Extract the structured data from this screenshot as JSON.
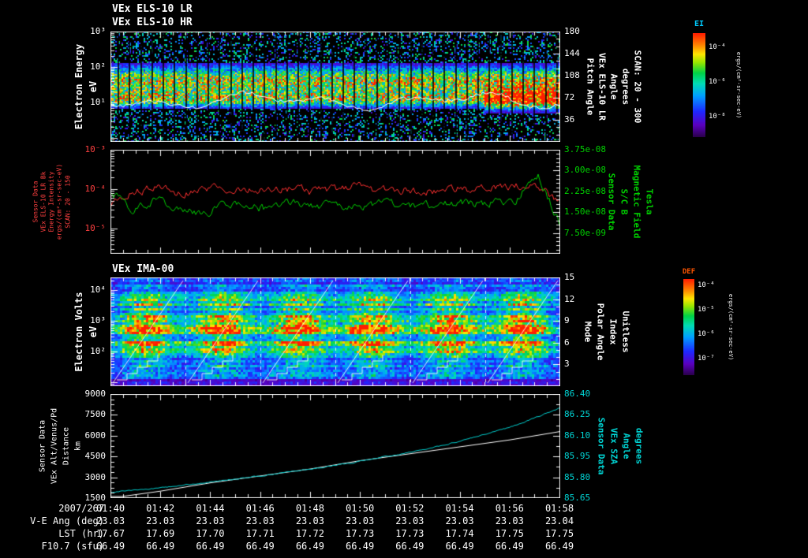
{
  "time_axis": {
    "date": "2007/267",
    "ticks": [
      "01:40",
      "01:42",
      "01:44",
      "01:46",
      "01:48",
      "01:50",
      "01:52",
      "01:54",
      "01:56",
      "01:58"
    ]
  },
  "footer_rows": [
    {
      "label": "V-E Ang (deg)",
      "values": [
        "23.03",
        "23.03",
        "23.03",
        "23.03",
        "23.03",
        "23.03",
        "23.03",
        "23.03",
        "23.03",
        "23.04"
      ]
    },
    {
      "label": "LST (hr)",
      "values": [
        "17.67",
        "17.69",
        "17.70",
        "17.71",
        "17.72",
        "17.73",
        "17.73",
        "17.74",
        "17.75",
        "17.75"
      ]
    },
    {
      "label": "F10.7 (sfu)",
      "values": [
        "66.49",
        "66.49",
        "66.49",
        "66.49",
        "66.49",
        "66.49",
        "66.49",
        "66.49",
        "66.49",
        "66.49"
      ]
    }
  ],
  "chart_data": [
    {
      "type": "heatmap",
      "name": "els_energy_spectrogram",
      "title_lines": [
        "VEx ELS-10 LR",
        "VEx ELS-10 HR"
      ],
      "description": "Electron energy-time spectrogram; intense 10-300 eV band, strongest red flux after 01:55, white pitch-angle trace overlay, vertical sweep gaps",
      "left_axis": {
        "label": "Electron Energy",
        "unit": "eV",
        "scale": "log",
        "ticks": [
          "10³",
          "10²",
          "10¹"
        ]
      },
      "right_axis": {
        "label_lines": [
          "Pitch Angle",
          "VEx ELS-10 LR",
          "Angle",
          "degrees",
          "SCAN: 20 - 300"
        ],
        "ticks": [
          "180",
          "144",
          "108",
          "72",
          "36"
        ],
        "range": [
          0,
          180
        ]
      },
      "colorbar": {
        "title": "EI",
        "ticks": [
          "10⁻⁴",
          "10⁻⁶",
          "10⁻⁸"
        ],
        "units": "ergs/(cm²-sr-sec-eV)"
      }
    },
    {
      "type": "line",
      "name": "intensity_and_bfield",
      "left_axis": {
        "label_lines": [
          "Sensor Data",
          "VEx ELS-10 LR Bk",
          "Energy Intensity",
          "ergs/(cm²-sr-sec-eV)",
          "SCAN: 20 - 150"
        ],
        "scale": "log",
        "ticks": [
          "10⁻³",
          "10⁻⁴",
          "10⁻⁵"
        ],
        "color": "#ff4040"
      },
      "right_axis": {
        "label_lines": [
          "Sensor Data",
          "S/C B",
          "Magnetic Field",
          "Tesla"
        ],
        "ticks": [
          "3.75e-08",
          "3.00e-08",
          "2.25e-08",
          "1.50e-08",
          "7.50e-09"
        ],
        "range": [
          0,
          3.75e-08
        ],
        "color": "#00d000"
      },
      "series": [
        {
          "name": "energy_intensity",
          "axis": "left",
          "color": "#ff3030",
          "values_log10": [
            -4.45,
            -4.05,
            -3.98,
            -4.1,
            -4.0,
            -3.95,
            -4.05,
            -4.02,
            -3.98,
            -4.06,
            -4.0,
            -3.96,
            -4.04,
            -4.0,
            -4.08,
            -3.97,
            -4.02,
            -3.99,
            -3.93,
            -3.88,
            -4.4
          ]
        },
        {
          "name": "magnetic_field_tesla",
          "axis": "right",
          "color": "#00d000",
          "values": [
            2.3e-08,
            1.5e-08,
            1.9e-08,
            1.65e-08,
            1.45e-08,
            1.7e-08,
            1.78e-08,
            1.62e-08,
            1.85e-08,
            1.7e-08,
            1.78e-08,
            1.68e-08,
            1.82e-08,
            1.75e-08,
            1.7e-08,
            1.85e-08,
            1.78e-08,
            1.88e-08,
            1.95e-08,
            2.85e-08,
            1.1e-08
          ]
        }
      ]
    },
    {
      "type": "heatmap",
      "name": "ima_spectrogram",
      "title": "VEx IMA-00",
      "description": "Ion spectrogram; six periodic bright green/orange blobs on blue background with white diagonal sweep lines and staircase mode traces",
      "blob_centers_frac": [
        0.075,
        0.245,
        0.415,
        0.58,
        0.75,
        0.915
      ],
      "left_axis": {
        "label": "Electron Volts",
        "unit": "eV",
        "scale": "log",
        "ticks": [
          "10⁴",
          "10³",
          "10²"
        ]
      },
      "right_axis": {
        "label_lines": [
          "Mode",
          "Polar Angle",
          "Index",
          "Unitless"
        ],
        "ticks": [
          "15",
          "12",
          "9",
          "6",
          "3"
        ],
        "range": [
          0,
          15
        ]
      },
      "colorbar": {
        "title": "DEF",
        "ticks": [
          "10⁻⁴",
          "10⁻⁵",
          "10⁻⁶",
          "10⁻⁷"
        ],
        "units": "ergs/(cm²-sr-sec-eV)"
      }
    },
    {
      "type": "line",
      "name": "altitude_and_sza",
      "left_axis": {
        "label_lines": [
          "Sensor Data",
          "VEx Alt/Venus/Pd",
          "Distance",
          "km"
        ],
        "ticks": [
          "9000",
          "7500",
          "6000",
          "4500",
          "3000",
          "1500"
        ],
        "range": [
          1500,
          9000
        ]
      },
      "right_axis": {
        "label_lines": [
          "Sensor Data",
          "VEx SZA",
          "Angle",
          "degrees"
        ],
        "ticks": [
          "86.40",
          "86.25",
          "86.10",
          "85.95",
          "85.80",
          "85.65"
        ],
        "range": [
          85.65,
          86.4
        ],
        "color": "#00d5d5"
      },
      "series": [
        {
          "name": "altitude_km",
          "axis": "left",
          "color": "#00cccc",
          "values": [
            1900,
            2250,
            2650,
            3100,
            3600,
            4150,
            4800,
            5600,
            6600,
            8000
          ]
        },
        {
          "name": "sza_deg",
          "axis": "right",
          "color": "#ffffff",
          "values": [
            85.65,
            85.7,
            85.76,
            85.81,
            85.86,
            85.92,
            85.97,
            86.02,
            86.07,
            86.13
          ]
        }
      ]
    }
  ]
}
